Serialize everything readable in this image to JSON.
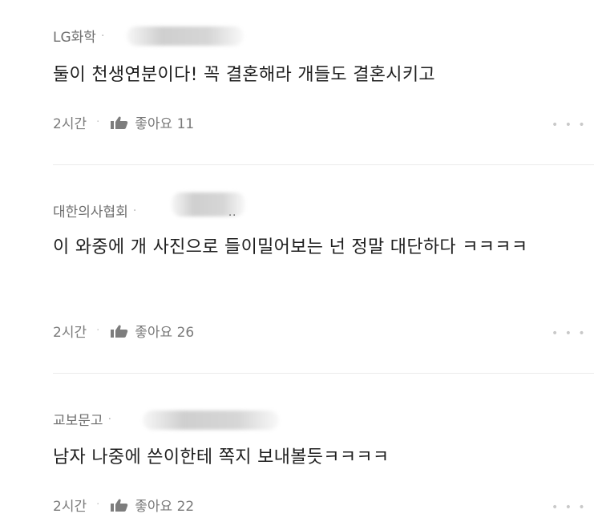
{
  "comments": [
    {
      "author": "LG화학",
      "text": "둘이 천생연분이다! 꼭 결혼해라 개들도 결혼시키고",
      "time": "2시간",
      "like_label": "좋아요 11",
      "more": "• • •"
    },
    {
      "author": "대한의사협회",
      "text": "이 와중에 개 사진으로 들이밀어보는 넌 정말 대단하다 ㅋㅋㅋㅋ",
      "time": "2시간",
      "like_label": "좋아요 26",
      "more": "• • •",
      "extra": ".."
    },
    {
      "author": "교보문고",
      "text": "남자 나중에 쓴이한테 쪽지 보내볼듯ㅋㅋㅋㅋ",
      "time": "2시간",
      "like_label": "좋아요 22",
      "more": "• • •"
    }
  ],
  "separator": "·",
  "icons": {
    "like": "thumbs-up-icon",
    "more": "more-icon"
  }
}
